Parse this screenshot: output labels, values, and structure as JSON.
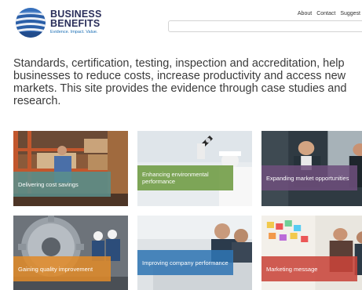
{
  "logo": {
    "line1": "BUSINESS",
    "line2": "BENEFITS",
    "tagline": "Evidence. Impact. Value."
  },
  "nav": {
    "about": "About",
    "contact": "Contact",
    "suggest": "Suggest"
  },
  "search": {
    "value": "",
    "placeholder": ""
  },
  "intro": {
    "line1": "Standards, certification, testing, inspection and accreditation, help",
    "line2": "businesses to reduce costs, increase productivity and access new",
    "line3": "markets. This site provides the evidence through case studies and",
    "line4": "research."
  },
  "tiles": [
    {
      "label": "Delivering cost savings",
      "color": "#5b8f8c"
    },
    {
      "label": "Enhancing environmental performance",
      "color": "#6c9a3f"
    },
    {
      "label": "Expanding market opportunities",
      "color": "#6e4e7c"
    },
    {
      "label": "Gaining quality improvement",
      "color": "#e08a2a"
    },
    {
      "label": "Improving company performance",
      "color": "#2f74b3"
    },
    {
      "label": "Marketing message",
      "color": "#c9443a"
    }
  ]
}
